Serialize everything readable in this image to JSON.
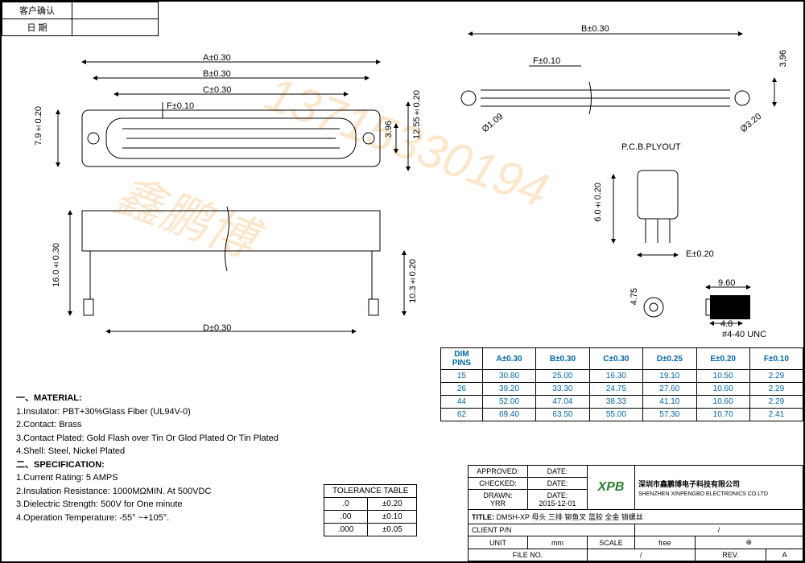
{
  "approval": {
    "cust_confirm": "客户确认",
    "date": "日 期"
  },
  "dims": {
    "A": "A±0.30",
    "B": "B±0.30",
    "C": "C±0.30",
    "D": "D±0.30",
    "E": "E±0.20",
    "F": "F±0.10",
    "h7_9": "7.9±0.20",
    "h12_55": "12.55±0.20",
    "h3_96": "3.96",
    "h3_96b": "3,96",
    "d1_09": "Ø1.09",
    "d3_20": "Ø3.20",
    "pcb": "P.C.B.PLYOUT",
    "h6_0": "6.0±0.20",
    "w9_60": "9.60",
    "w4_8": "4.8",
    "h4_75": "4.75",
    "thread": "#4-40 UNC",
    "h16": "16.0±0.30",
    "h10_3": "10.3±0.20"
  },
  "chart_data": {
    "type": "table",
    "title": "DIM / PINS",
    "columns": [
      "A±0.30",
      "B±0.30",
      "C±0.30",
      "D±0.25",
      "E±0.20",
      "F±0.10"
    ],
    "rows": [
      {
        "pins": "15",
        "v": [
          "30.80",
          "25.00",
          "16.30",
          "19.10",
          "10.50",
          "2.29"
        ]
      },
      {
        "pins": "26",
        "v": [
          "39.20",
          "33.30",
          "24.75",
          "27.60",
          "10.60",
          "2.29"
        ]
      },
      {
        "pins": "44",
        "v": [
          "52.00",
          "47.04",
          "38.33",
          "41.10",
          "10.60",
          "2.29"
        ]
      },
      {
        "pins": "62",
        "v": [
          "69.40",
          "63.50",
          "55.00",
          "57.30",
          "10.70",
          "2.41"
        ]
      }
    ]
  },
  "dim_hdr": {
    "dim": "DIM",
    "pins": "PINS"
  },
  "material": {
    "hdr": "一、MATERIAL:",
    "l1": "1.Insulator: PBT+30%Glass Fiber (UL94V-0)",
    "l2": "2.Contact: Brass",
    "l3": "3.Contact Plated: Gold Flash over Tin Or Glod Plated Or Tin Plated",
    "l4": "4.Shell: Steel, Nickel Plated"
  },
  "spec": {
    "hdr": "二、SPECIFICATION:",
    "l1": "1.Current Rating: 5 AMPS",
    "l2": "2.Insulation Resistance: 1000MΩMIN. At 500VDC",
    "l3": "3.Dielectric Strength: 500V for One minute",
    "l4": "4.Operation Temperature: -55° ~+105°."
  },
  "tol": {
    "title": "TOLERANCE TABLE",
    "r1a": ".0",
    "r1b": "±0.20",
    "r2a": ".00",
    "r2b": "±0.10",
    "r3a": ".000",
    "r3b": "±0.05"
  },
  "tb": {
    "approved": "APPROVED:",
    "checked": "CHECKED:",
    "drawn": "DRAWN:",
    "drawn_v": "YRR",
    "date": "DATE:",
    "date_v": "2015-12-01",
    "company_cn": "深圳市鑫鹏博电子科技有限公司",
    "company_en": "SHENZHEN XINPENGBO ELECTRONICS CO.LTD",
    "logo": "XPB",
    "title": "TITLE:",
    "title_v": "DMSH-XP 母头 三排 铆鱼叉 蓝胶 全金 锁螺丝",
    "client": "CLIENT P/N",
    "client_v": "/",
    "unit": "UNIT",
    "unit_v": "mm",
    "scale": "SCALE",
    "scale_v": "free",
    "file": "FILE NO.",
    "file_v": "/",
    "rev": "REV.",
    "rev_v": "A",
    "proj": "⊕"
  },
  "wm1": "鑫鹏博",
  "wm2": "13715330194"
}
